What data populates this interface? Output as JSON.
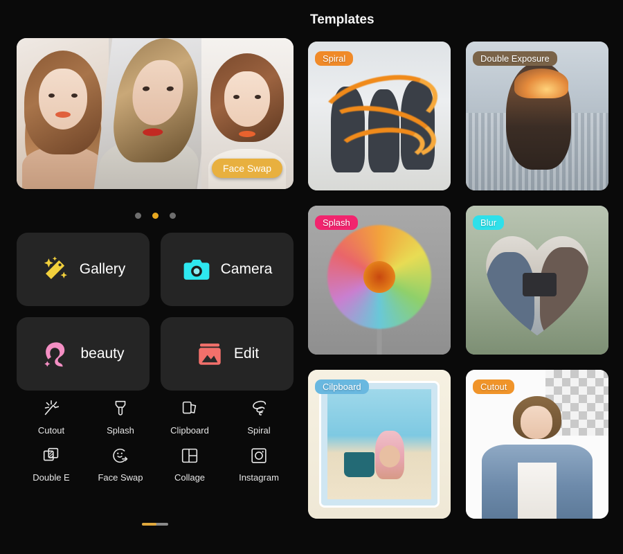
{
  "hero": {
    "badge_label": "Face Swap",
    "panel_count": 3
  },
  "carousel": {
    "dots": [
      {
        "active": false
      },
      {
        "active": true
      },
      {
        "active": false
      }
    ],
    "active_index": 1,
    "active_color": "#e8a820",
    "inactive_color": "#6e6e6e"
  },
  "actions": {
    "rows": [
      [
        {
          "label": "Gallery",
          "icon": "magic-wand-icon",
          "color": "#f2d03c"
        },
        {
          "label": "Camera",
          "icon": "camera-icon",
          "color": "#2ee8f0"
        }
      ],
      [
        {
          "label": "beauty",
          "icon": "beauty-face-icon",
          "color": "#f48fc4"
        },
        {
          "label": "Edit",
          "icon": "photo-edit-icon",
          "color": "#f2706b"
        }
      ]
    ]
  },
  "tools": {
    "rows": [
      [
        {
          "label": "Cutout",
          "icon": "cutout-wand-icon"
        },
        {
          "label": "Splash",
          "icon": "splash-brush-icon"
        },
        {
          "label": "Clipboard",
          "icon": "clipboard-cards-icon"
        },
        {
          "label": "Spiral",
          "icon": "spiral-swirl-icon"
        }
      ],
      [
        {
          "label": "Double E",
          "icon": "double-exposure-icon"
        },
        {
          "label": "Face Swap",
          "icon": "face-swap-icon"
        },
        {
          "label": "Collage",
          "icon": "collage-grid-icon"
        },
        {
          "label": "Instagram",
          "icon": "instagram-icon"
        }
      ]
    ]
  },
  "scrollbar": {
    "fill_percent": 55,
    "fill_color": "#e0a83c",
    "track_color": "#8a8a8a"
  },
  "templates": {
    "title": "Templates",
    "cards": [
      {
        "badge": "Spiral",
        "badge_color": "#f08a28",
        "art": "art-spiral"
      },
      {
        "badge": "Double Exposure",
        "badge_color": "#7a6348",
        "art": "art-dexp"
      },
      {
        "badge": "Splash",
        "badge_color": "#f2246e",
        "art": "art-splash"
      },
      {
        "badge": "Blur",
        "badge_color": "#2fe0ea",
        "art": "art-blur"
      },
      {
        "badge": "Cilpboard",
        "badge_color": "#69b8e0",
        "art": "art-clip"
      },
      {
        "badge": "Cutout",
        "badge_color": "#f0942a",
        "art": "art-cut"
      }
    ]
  },
  "theme": {
    "background": "#0a0a0a",
    "card_background": "#252525",
    "text_primary": "#ffffff"
  }
}
